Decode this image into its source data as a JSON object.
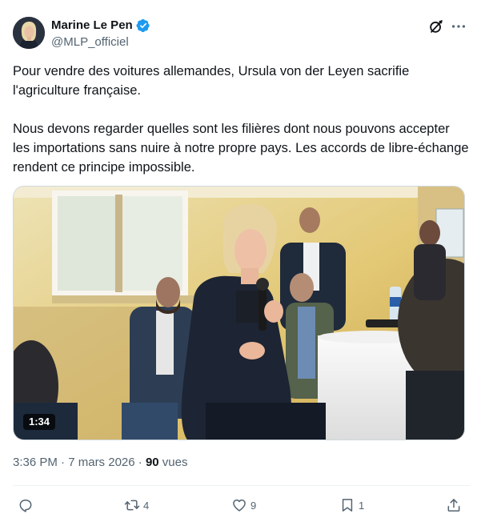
{
  "author": {
    "display_name": "Marine Le Pen",
    "handle": "@MLP_officiel",
    "verified": true
  },
  "tweet": {
    "paragraphs": [
      "Pour vendre des voitures allemandes, Ursula von der Leyen sacrifie l'agriculture française.",
      "Nous devons regarder quelles sont les filières dont nous pouvons accepter les importations sans nuire à notre propre pays. Les accords de libre-échange rendent ce principe impossible."
    ]
  },
  "media": {
    "type": "video",
    "duration": "1:34"
  },
  "meta": {
    "time": "3:36 PM",
    "separator": " · ",
    "date": "7 mars 2026",
    "views_count": "90",
    "views_label": " vues"
  },
  "actions": {
    "reply_count": "",
    "retweet_count": "4",
    "like_count": "9",
    "bookmark_count": "1"
  },
  "icons": {
    "header": [
      "grok-icon",
      "more-icon"
    ],
    "actions": [
      "reply-icon",
      "retweet-icon",
      "like-icon",
      "bookmark-icon",
      "share-icon"
    ]
  },
  "colors": {
    "text": "#0f1419",
    "secondary": "#536471",
    "verified_blue": "#1d9bf0",
    "divider": "#eff3f4"
  }
}
